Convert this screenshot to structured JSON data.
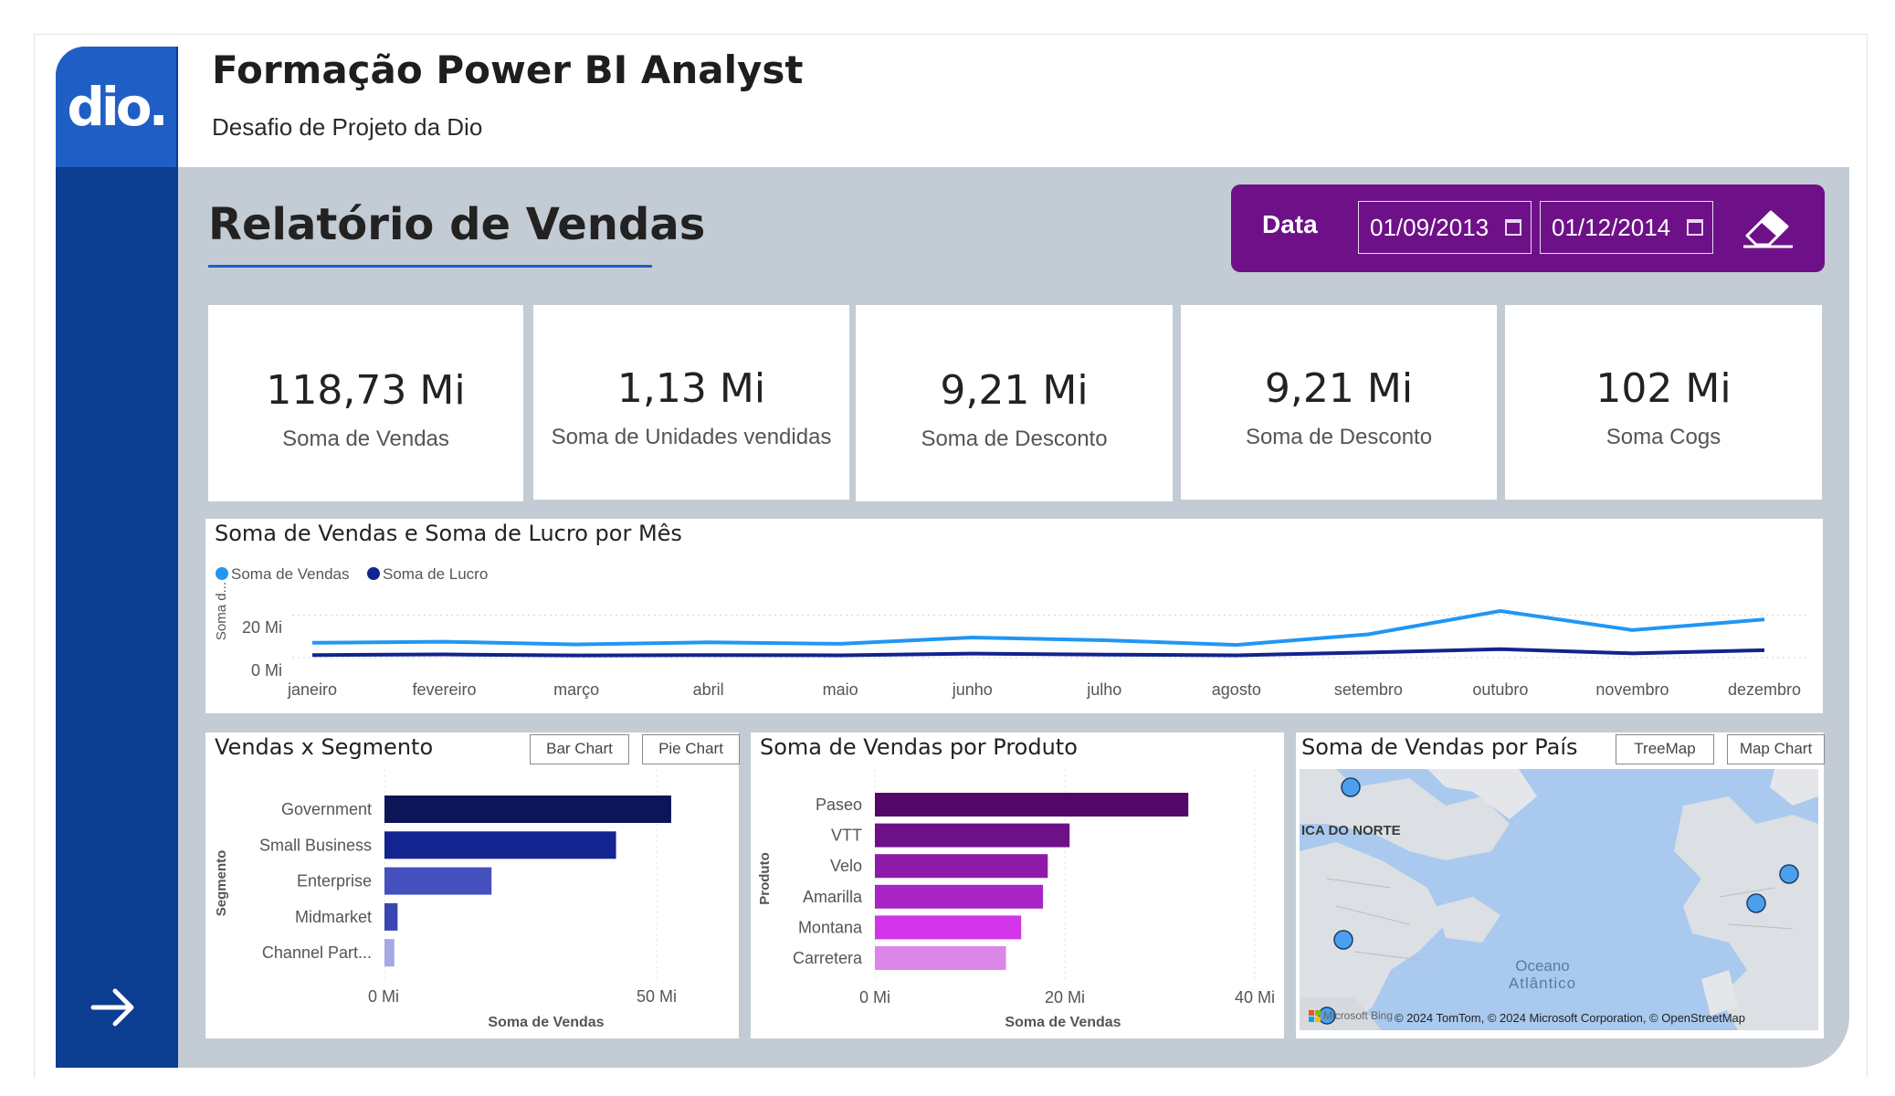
{
  "header": {
    "logo_text": "dio.",
    "title": "Formação Power BI Analyst",
    "subtitle": "Desafio de Projeto da Dio"
  },
  "report": {
    "title": "Relatório de Vendas"
  },
  "date_filter": {
    "label": "Data",
    "start": "01/09/2013",
    "end": "01/12/2014"
  },
  "kpis": [
    {
      "value": "118,73 Mi",
      "label": "Soma de Vendas"
    },
    {
      "value": "1,13 Mi",
      "label": "Soma de Unidades vendidas"
    },
    {
      "value": "9,21 Mi",
      "label": "Soma de Desconto"
    },
    {
      "value": "9,21 Mi",
      "label": "Soma de Desconto"
    },
    {
      "value": "102 Mi",
      "label": "Soma Cogs"
    }
  ],
  "line_chart": {
    "title": "Soma de Vendas e Soma de Lucro por Mês",
    "ylabel": "Soma d...",
    "ytick_labels": [
      "20 Mi",
      "0 Mi"
    ]
  },
  "segment_chart": {
    "title": "Vendas x Segmento",
    "buttons": [
      "Bar Chart",
      "Pie Chart"
    ],
    "tick_labels": [
      "0 Mi",
      "50 Mi"
    ]
  },
  "product_chart": {
    "title": "Soma de Vendas por Produto",
    "tick_labels": [
      "0 Mi",
      "20 Mi",
      "40 Mi"
    ]
  },
  "map": {
    "title": "Soma de Vendas por País",
    "buttons": [
      "TreeMap",
      "Map Chart"
    ],
    "region_label": "ICA DO NORTE",
    "ocean_label_1": "Oceano",
    "ocean_label_2": "Atlântico",
    "bing_label": "Microsoft Bing",
    "attribution": "© 2024 TomTom, © 2024 Microsoft Corporation, © OpenStreetMap"
  },
  "colors": {
    "sidebar": "#0b3d91",
    "date_panel": "#6e1188",
    "sales_line": "#2196f3",
    "profit_line": "#13238f"
  },
  "chart_data": [
    {
      "type": "line",
      "title": "Soma de Vendas e Soma de Lucro por Mês",
      "ylabel": "Soma d...",
      "x": [
        "janeiro",
        "fevereiro",
        "março",
        "abril",
        "maio",
        "junho",
        "julho",
        "agosto",
        "setembro",
        "outubro",
        "novembro",
        "dezembro"
      ],
      "ylim": [
        0,
        25
      ],
      "grid": true,
      "legend": "top-left",
      "series": [
        {
          "name": "Soma de Vendas",
          "color": "#2196f3",
          "values": [
            7.0,
            7.5,
            6.2,
            7.2,
            6.5,
            9.5,
            8.2,
            6.0,
            11.0,
            22.0,
            13.0,
            18.0
          ]
        },
        {
          "name": "Soma de Lucro",
          "color": "#13238f",
          "values": [
            1.2,
            1.5,
            1.0,
            1.2,
            1.1,
            1.9,
            1.4,
            1.1,
            2.4,
            4.0,
            2.0,
            3.5
          ]
        }
      ]
    },
    {
      "type": "bar",
      "orientation": "horizontal",
      "title": "Vendas x Segmento",
      "xlabel": "Soma de Vendas",
      "ylabel": "Segmento",
      "categories": [
        "Government",
        "Small Business",
        "Enterprise",
        "Midmarket",
        "Channel Part..."
      ],
      "values": [
        52.5,
        42.4,
        19.6,
        2.4,
        1.8
      ],
      "colors": [
        "#0b1557",
        "#13238f",
        "#4450bd",
        "#3a46b0",
        "#a5a8e2"
      ],
      "xlim": [
        0,
        65
      ]
    },
    {
      "type": "bar",
      "orientation": "horizontal",
      "title": "Soma de Vendas por Produto",
      "xlabel": "Soma de Vendas",
      "ylabel": "Produto",
      "categories": [
        "Paseo",
        "VTT",
        "Velo",
        "Amarilla",
        "Montana",
        "Carretera"
      ],
      "values": [
        33.0,
        20.5,
        18.2,
        17.7,
        15.4,
        13.8
      ],
      "colors": [
        "#520866",
        "#6e1188",
        "#8f1aa8",
        "#a824c4",
        "#d235e8",
        "#dd86ea"
      ],
      "xlim": [
        0,
        42
      ]
    }
  ]
}
